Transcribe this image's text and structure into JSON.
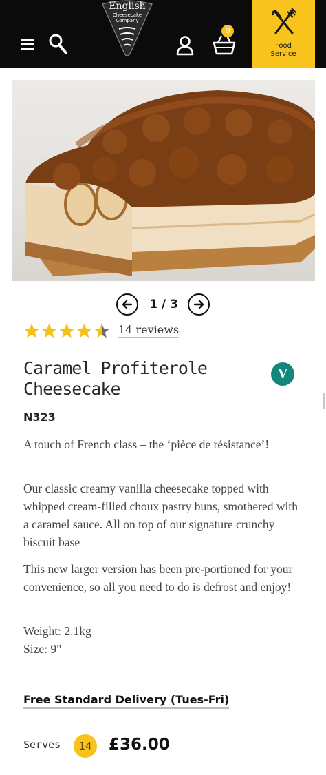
{
  "header": {
    "logo_title": "English",
    "logo_subtitle": "Cheesecake",
    "logo_subtitle2": "Company",
    "basket_count": "0",
    "food_service_label_line1": "Food",
    "food_service_label_line2": "Service",
    "icons": [
      "menu-icon",
      "search-icon",
      "account-icon",
      "basket-icon",
      "cutlery-icon"
    ]
  },
  "carousel": {
    "counter": "1 / 3",
    "current": 1,
    "total": 3
  },
  "rating": {
    "stars": 4.5,
    "max_stars": 5,
    "reviews_text": "14 reviews"
  },
  "product": {
    "title": "Caramel Profiterole Cheesecake",
    "veg_badge": "V",
    "code": "N323",
    "intro": "A touch of French class – the ‘pièce de résistance’!",
    "description": "Our classic creamy vanilla cheesecake topped with whipped cream-filled choux pastry buns, smothered with a caramel sauce. All on top of our signature crunchy biscuit base",
    "note": "This new larger version has been pre-portioned for your convenience, so all you need to do is defrost and enjoy!",
    "weight": "Weight: 2.1kg",
    "size": "Size: 9\""
  },
  "delivery": {
    "label": "Free Standard Delivery (Tues-Fri)"
  },
  "purchase": {
    "serves_label": "Serves",
    "serves_count": "14",
    "price": "£36.00"
  },
  "colors": {
    "header_bg": "#0b0b0b",
    "accent_yellow": "#f7c31c",
    "veg_green": "#14877c",
    "star_yellow": "#f5c21c"
  }
}
